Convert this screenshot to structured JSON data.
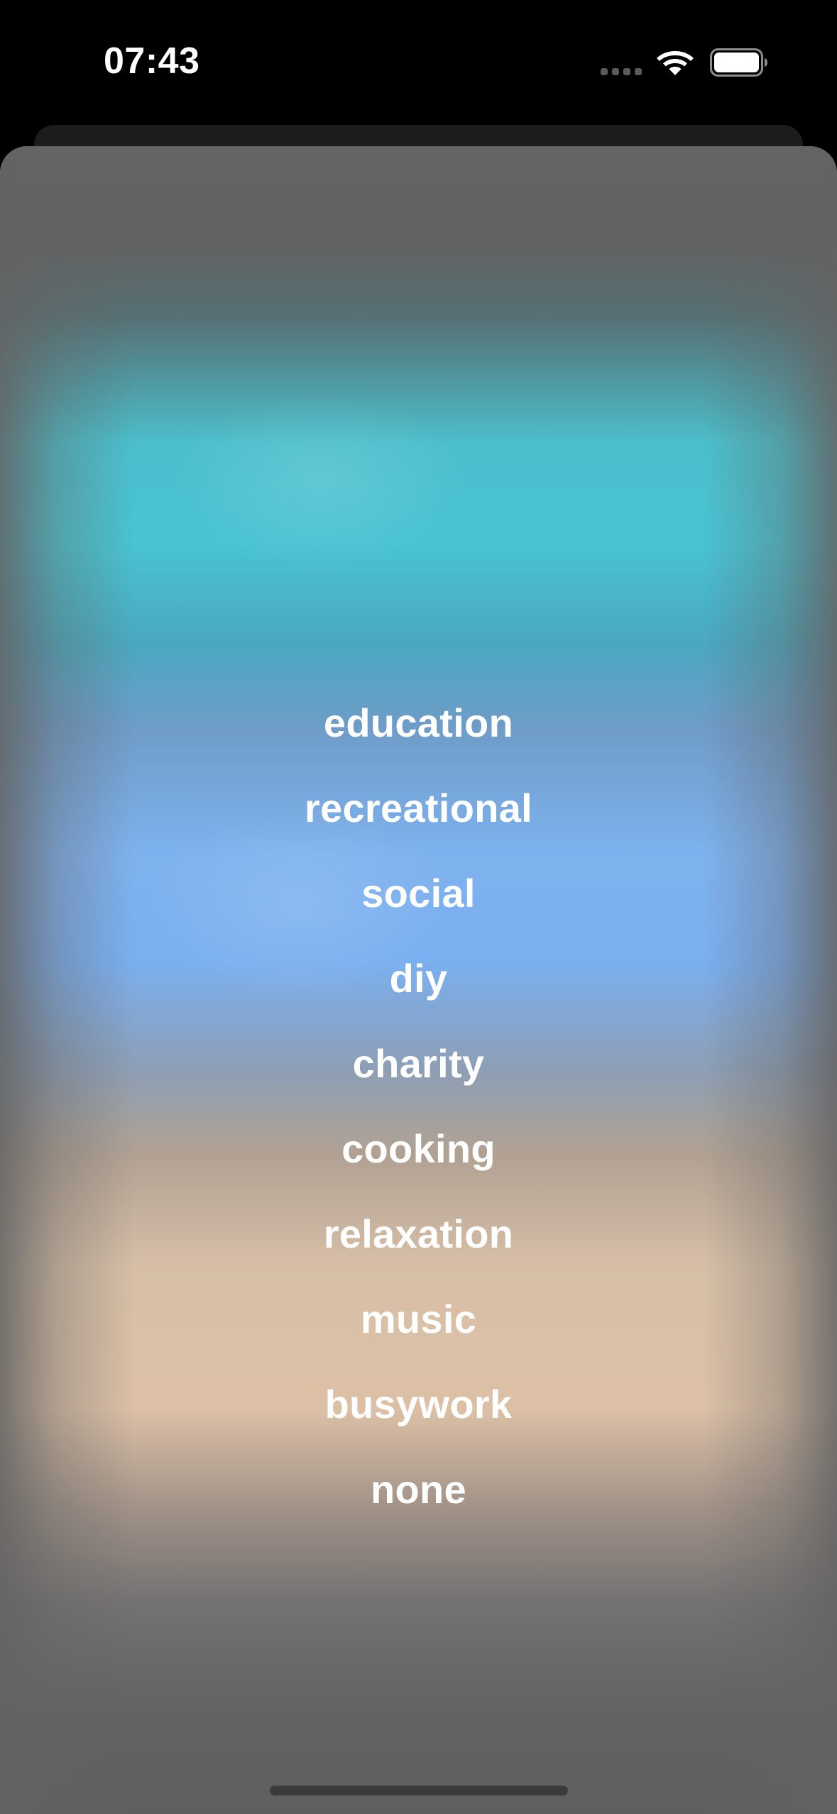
{
  "status_bar": {
    "time": "07:43",
    "icons": [
      "signal-dots-icon",
      "wifi-icon",
      "battery-icon"
    ]
  },
  "colors": {
    "background": "#000000",
    "sheet_gray": "#636363",
    "teal_band": "#49c3d2",
    "blue_band": "#7aaff0",
    "peach_band": "#dcc0a6",
    "text": "#ffffff"
  },
  "categories": [
    {
      "label": "education"
    },
    {
      "label": "recreational"
    },
    {
      "label": "social"
    },
    {
      "label": "diy"
    },
    {
      "label": "charity"
    },
    {
      "label": "cooking"
    },
    {
      "label": "relaxation"
    },
    {
      "label": "music"
    },
    {
      "label": "busywork"
    },
    {
      "label": "none"
    }
  ]
}
